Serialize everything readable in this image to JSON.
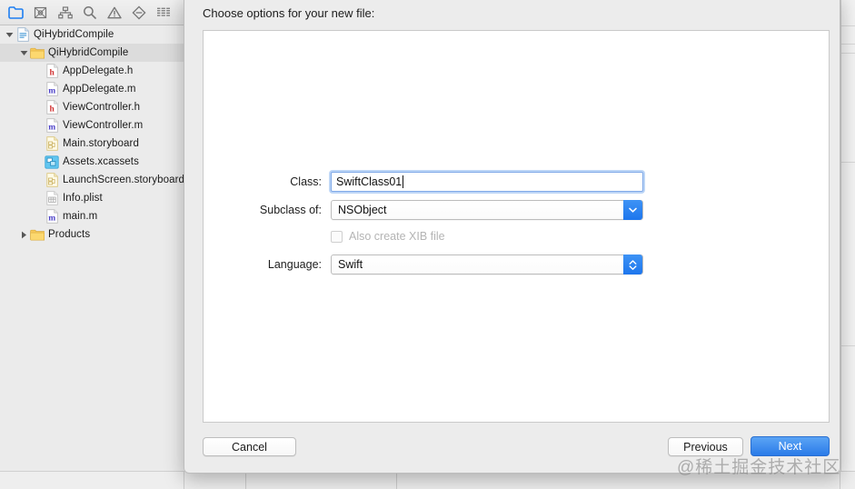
{
  "navigator": {
    "tabs": [
      {
        "name": "project-navigator",
        "icon": "folder-icon",
        "active": true
      },
      {
        "name": "source-control-navigator",
        "icon": "source-control-icon",
        "active": false
      },
      {
        "name": "symbol-navigator",
        "icon": "hierarchy-icon",
        "active": false
      },
      {
        "name": "find-navigator",
        "icon": "search-icon",
        "active": false
      },
      {
        "name": "issue-navigator",
        "icon": "warning-triangle-icon",
        "active": false
      },
      {
        "name": "test-navigator",
        "icon": "diamond-minus-icon",
        "active": false
      },
      {
        "name": "debug-navigator",
        "icon": "list-lines-icon",
        "active": false
      }
    ],
    "tree": [
      {
        "label": "QiHybridCompile",
        "icon": "xcode-project-icon",
        "indent": 0,
        "disclosure": "open",
        "selected": false
      },
      {
        "label": "QiHybridCompile",
        "icon": "folder-icon",
        "indent": 1,
        "disclosure": "open",
        "selected": true
      },
      {
        "label": "AppDelegate.h",
        "icon": "header-file-icon",
        "indent": 2,
        "disclosure": "none",
        "selected": false
      },
      {
        "label": "AppDelegate.m",
        "icon": "objc-file-icon",
        "indent": 2,
        "disclosure": "none",
        "selected": false
      },
      {
        "label": "ViewController.h",
        "icon": "header-file-icon",
        "indent": 2,
        "disclosure": "none",
        "selected": false
      },
      {
        "label": "ViewController.m",
        "icon": "objc-file-icon",
        "indent": 2,
        "disclosure": "none",
        "selected": false
      },
      {
        "label": "Main.storyboard",
        "icon": "storyboard-file-icon",
        "indent": 2,
        "disclosure": "none",
        "selected": false
      },
      {
        "label": "Assets.xcassets",
        "icon": "assets-catalog-icon",
        "indent": 2,
        "disclosure": "none",
        "selected": false
      },
      {
        "label": "LaunchScreen.storyboard",
        "icon": "storyboard-file-icon",
        "indent": 2,
        "disclosure": "none",
        "selected": false
      },
      {
        "label": "Info.plist",
        "icon": "plist-file-icon",
        "indent": 2,
        "disclosure": "none",
        "selected": false
      },
      {
        "label": "main.m",
        "icon": "objc-file-icon",
        "indent": 2,
        "disclosure": "none",
        "selected": false
      },
      {
        "label": "Products",
        "icon": "folder-icon",
        "indent": 1,
        "disclosure": "closed",
        "selected": false
      }
    ]
  },
  "sheet": {
    "title": "Choose options for your new file:",
    "fields": {
      "class": {
        "label": "Class:",
        "value": "SwiftClass01",
        "placeholder": "",
        "focused": true
      },
      "subclass": {
        "label": "Subclass of:",
        "value": "NSObject"
      },
      "xib": {
        "label": "Also create XIB file",
        "checked": false,
        "enabled": false
      },
      "language": {
        "label": "Language:",
        "value": "Swift"
      }
    },
    "buttons": {
      "cancel": "Cancel",
      "previous": "Previous",
      "next": "Next"
    }
  },
  "watermark": {
    "text": "@稀土掘金技术社区"
  },
  "colors": {
    "accent": "#2a7be8",
    "focus_ring": "#6aa2eb",
    "selected_row": "#dcdcdc",
    "sheet_bg": "#ececec",
    "navigator_bg": "#ebebeb"
  }
}
